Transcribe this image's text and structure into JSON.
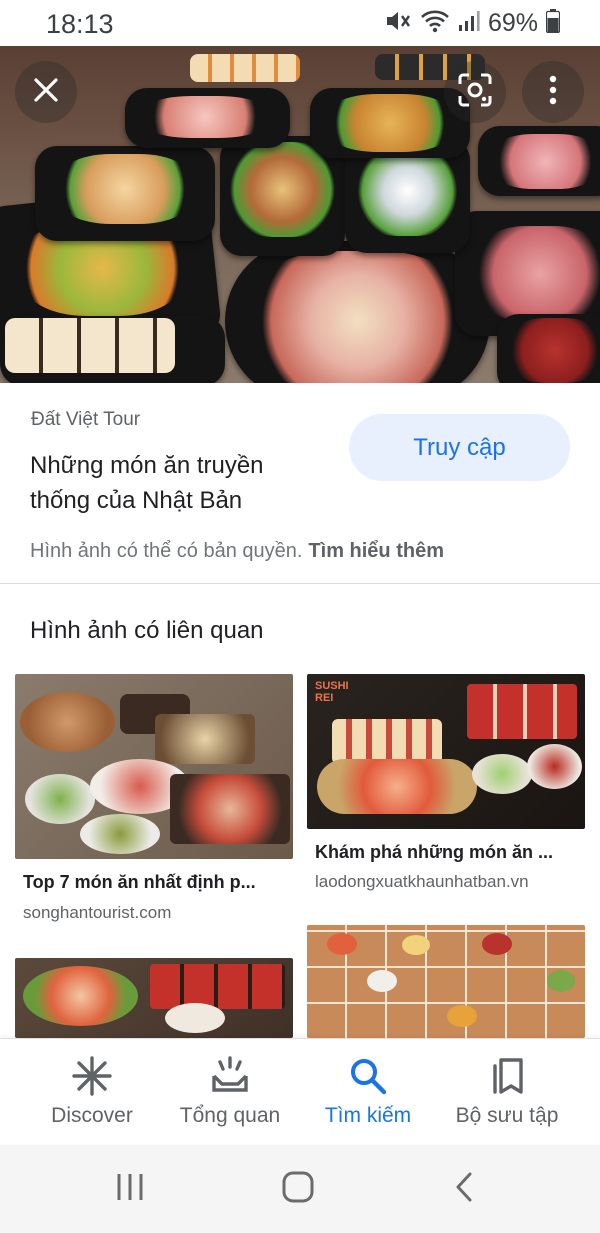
{
  "status_bar": {
    "time": "18:13",
    "battery": "69%",
    "icons": [
      "mute-icon",
      "wifi-icon",
      "signal-icon",
      "battery-icon"
    ]
  },
  "hero": {
    "icons": [
      "close-icon",
      "lens-icon",
      "more-vert-icon"
    ]
  },
  "result": {
    "source": "Đất Việt Tour",
    "title": "Những món ăn truyền thống của Nhật Bản",
    "visit_label": "Truy cập",
    "copyright_text": "Hình ảnh có thể có bản quyền.",
    "learn_more": "Tìm hiểu thêm"
  },
  "related": {
    "heading": "Hình ảnh có liên quan",
    "items": [
      {
        "title": "Top 7 món ăn nhất định p...",
        "source": "songhantourist.com"
      },
      {
        "title": "Khám phá những món ăn ...",
        "source": "laodongxuatkhaunhatban.vn",
        "logo_text": "SUSHI REI"
      },
      {
        "title": "",
        "source": ""
      },
      {
        "title": "",
        "source": ""
      }
    ]
  },
  "bottom_nav": {
    "items": [
      {
        "label": "Discover",
        "icon": "asterisk-icon"
      },
      {
        "label": "Tổng quan",
        "icon": "updates-icon"
      },
      {
        "label": "Tìm kiếm",
        "icon": "search-icon",
        "active": true
      },
      {
        "label": "Bộ sưu tập",
        "icon": "collections-icon"
      }
    ]
  },
  "colors": {
    "accent": "#1a73e8",
    "visit_button_bg": "#e8f0fe",
    "text_primary": "#202124",
    "text_secondary": "#5f6368"
  }
}
